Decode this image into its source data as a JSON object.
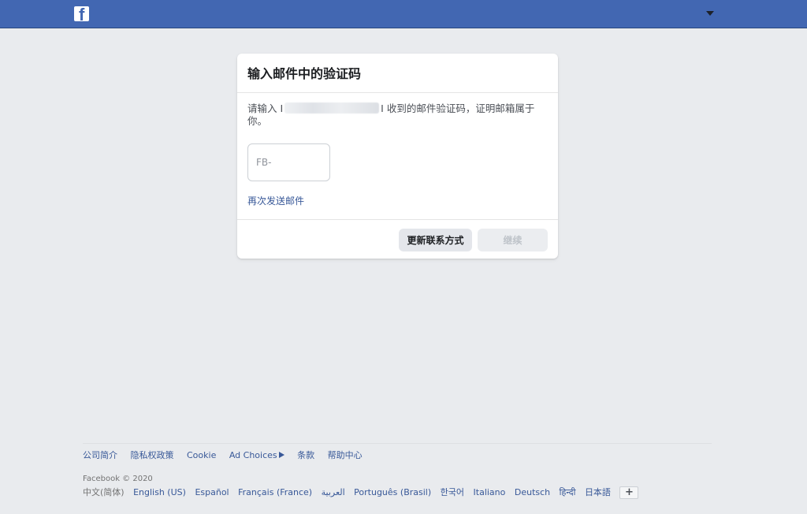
{
  "header": {
    "logo_letter": "f",
    "brand_color": "#4267b2",
    "menu_icon": "caret-down-icon"
  },
  "card": {
    "title": "输入邮件中的验证码",
    "desc_prefix": "请输入 I",
    "desc_suffix": "I 收到的邮件验证码，证明邮箱属于你。",
    "code_placeholder": "FB-",
    "resend_label": "再次发送邮件",
    "update_contact_label": "更新联系方式",
    "continue_label": "继续"
  },
  "footer": {
    "links": [
      "公司简介",
      "隐私权政策",
      "Cookie",
      "Ad Choices",
      "条款",
      "帮助中心"
    ],
    "adchoices_icon": "adchoices-icon",
    "copyright": "Facebook © 2020",
    "current_language": "中文(简体)",
    "languages": [
      "English (US)",
      "Español",
      "Français (France)",
      "العربية",
      "Português (Brasil)",
      "한국어",
      "Italiano",
      "Deutsch",
      "हिन्दी",
      "日本語"
    ],
    "more_languages_label": "+"
  }
}
